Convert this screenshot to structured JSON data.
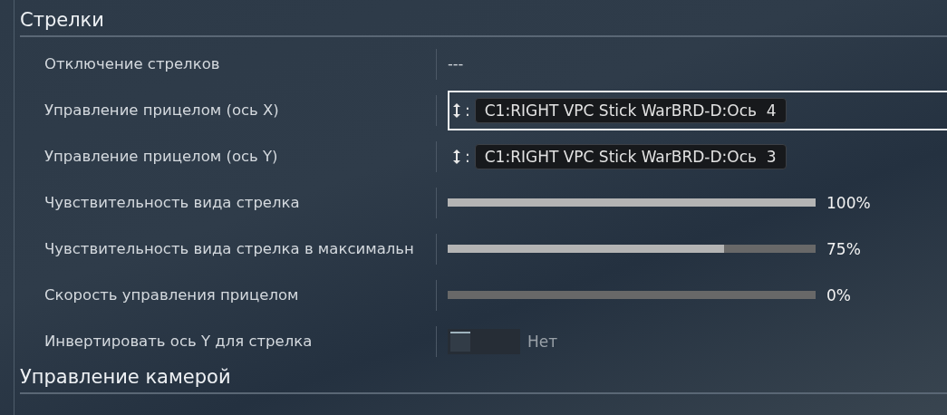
{
  "sections": [
    {
      "title": "Стрелки",
      "rows": [
        {
          "kind": "text",
          "label": "Отключение стрелков",
          "value": "---"
        },
        {
          "kind": "axis",
          "label": "Управление прицелом (ось X)",
          "selected": true,
          "separator": ":",
          "binding": "C1:RIGHT VPC Stick WarBRD-D:Ось  4"
        },
        {
          "kind": "axis",
          "label": "Управление прицелом (ось Y)",
          "selected": false,
          "separator": ":",
          "binding": "C1:RIGHT VPC Stick WarBRD-D:Ось  3"
        },
        {
          "kind": "slider",
          "label": "Чувствительность вида стрелка",
          "level": 1,
          "reading": "100%"
        },
        {
          "kind": "slider",
          "label": "Чувствительность вида стрелка в максимальн",
          "level": 0.75,
          "reading": "75%"
        },
        {
          "kind": "slider",
          "label": "Скорость управления прицелом",
          "level": 0,
          "reading": "0%"
        },
        {
          "kind": "toggle",
          "label": "Инвертировать ось Y для стрелка",
          "on": false,
          "value": "Нет"
        }
      ]
    },
    {
      "title": "Управление камерой"
    }
  ]
}
